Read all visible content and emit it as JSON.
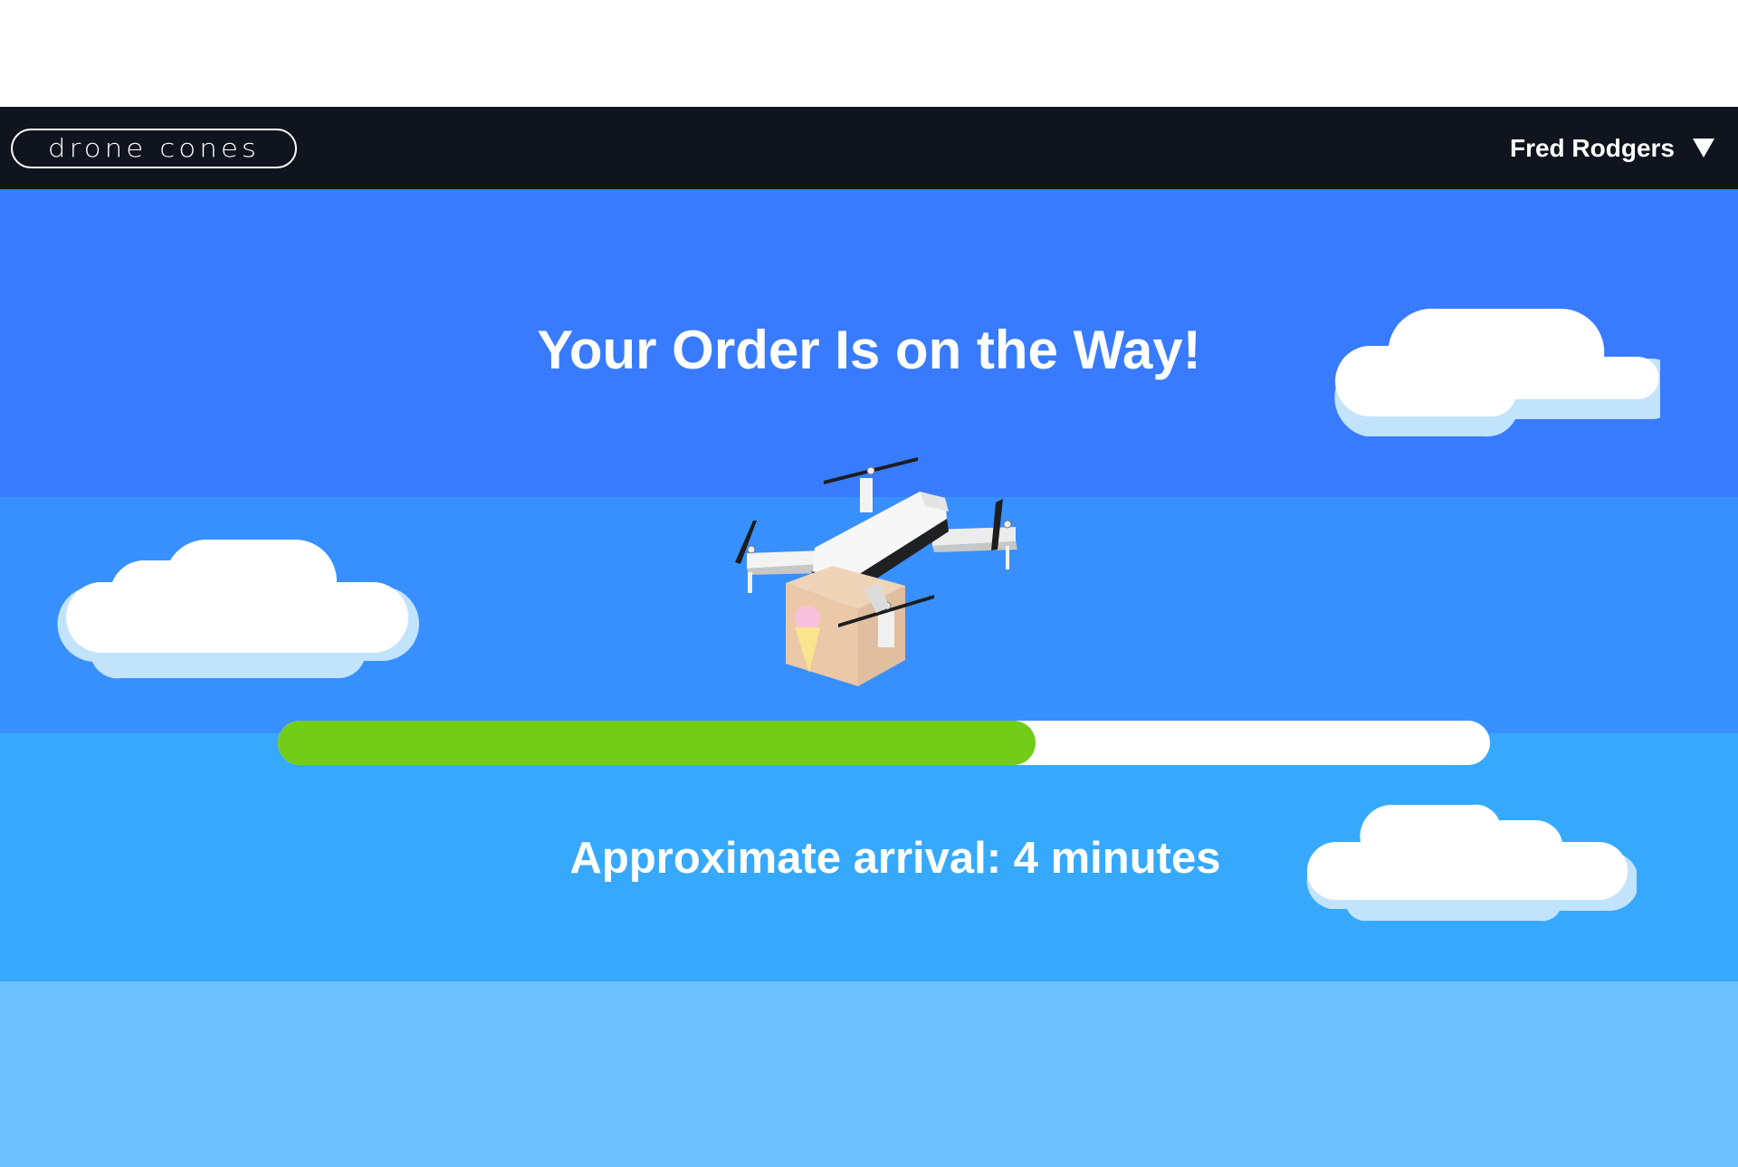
{
  "header": {
    "logo_text": "drone cones",
    "user_name": "Fred Rodgers"
  },
  "main": {
    "title": "Your Order Is on the Way!",
    "arrival_text": "Approximate arrival: 4 minutes",
    "progress_fraction": 0.625
  },
  "colors": {
    "navbar": "#10141f",
    "sky_band_1": "#387bfe",
    "sky_band_2": "#3790fd",
    "sky_band_3": "#37a9fd",
    "sky_band_4": "#6bc1fd",
    "progress_fill": "#72cc18",
    "progress_track": "#ffffff",
    "cloud": "#ffffff",
    "cloud_shadow": "#c2e3fc"
  },
  "icons": {
    "user_menu": "caret-down-icon",
    "hero": "delivery-drone-illustration"
  }
}
